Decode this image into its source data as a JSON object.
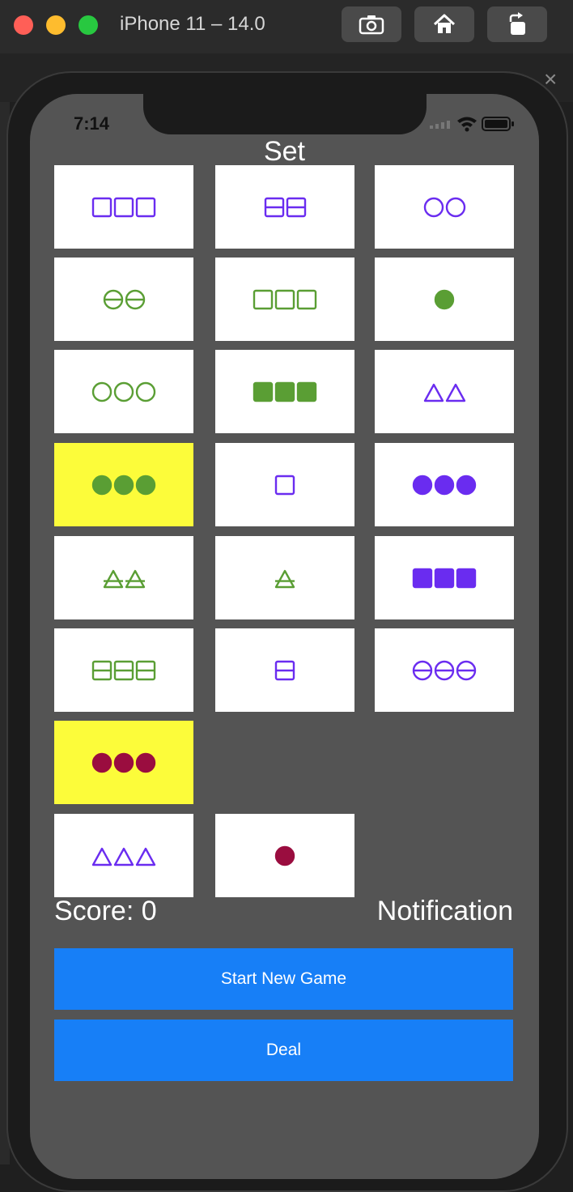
{
  "window": {
    "title": "iPhone 11 – 14.0",
    "toolbar": [
      "screenshot-icon",
      "home-icon",
      "rotate-icon"
    ]
  },
  "status_bar": {
    "time": "7:14",
    "icons": [
      "signal-icon",
      "wifi-icon",
      "battery-icon"
    ]
  },
  "app": {
    "title": "Set"
  },
  "colors": {
    "purple": "#6a2cf0",
    "green": "#5a9e34",
    "maroon": "#9a0d3f",
    "selected": "#fcfc3a",
    "button": "#177ff7"
  },
  "cards": [
    {
      "count": 3,
      "shape": "square",
      "fill": "open",
      "color": "purple",
      "selected": false
    },
    {
      "count": 2,
      "shape": "square",
      "fill": "striped",
      "color": "purple",
      "selected": false
    },
    {
      "count": 2,
      "shape": "circle",
      "fill": "open",
      "color": "purple",
      "selected": false
    },
    {
      "count": 2,
      "shape": "circle",
      "fill": "striped",
      "color": "green",
      "selected": false
    },
    {
      "count": 3,
      "shape": "square",
      "fill": "open",
      "color": "green",
      "selected": false
    },
    {
      "count": 1,
      "shape": "circle",
      "fill": "solid",
      "color": "green",
      "selected": false
    },
    {
      "count": 3,
      "shape": "circle",
      "fill": "open",
      "color": "green",
      "selected": false
    },
    {
      "count": 3,
      "shape": "square",
      "fill": "solid",
      "color": "green",
      "selected": false
    },
    {
      "count": 2,
      "shape": "triangle",
      "fill": "open",
      "color": "purple",
      "selected": false
    },
    {
      "count": 3,
      "shape": "circle",
      "fill": "solid",
      "color": "green",
      "selected": true
    },
    {
      "count": 1,
      "shape": "square",
      "fill": "open",
      "color": "purple",
      "selected": false
    },
    {
      "count": 3,
      "shape": "circle",
      "fill": "solid",
      "color": "purple",
      "selected": false
    },
    {
      "count": 2,
      "shape": "triangle",
      "fill": "striped",
      "color": "green",
      "selected": false
    },
    {
      "count": 1,
      "shape": "triangle",
      "fill": "striped",
      "color": "green",
      "selected": false
    },
    {
      "count": 3,
      "shape": "square",
      "fill": "solid",
      "color": "purple",
      "selected": false
    },
    {
      "count": 3,
      "shape": "square",
      "fill": "striped",
      "color": "green",
      "selected": false
    },
    {
      "count": 1,
      "shape": "square",
      "fill": "striped",
      "color": "purple",
      "selected": false
    },
    {
      "count": 3,
      "shape": "circle",
      "fill": "striped",
      "color": "purple",
      "selected": false
    },
    {
      "count": 3,
      "shape": "circle",
      "fill": "solid",
      "color": "maroon",
      "selected": true
    },
    null,
    null,
    {
      "count": 3,
      "shape": "triangle",
      "fill": "open",
      "color": "purple",
      "selected": false
    },
    {
      "count": 1,
      "shape": "circle",
      "fill": "solid",
      "color": "maroon",
      "selected": false
    }
  ],
  "score_label": "Score: 0",
  "notification": "Notification",
  "buttons": {
    "new_game": "Start New Game",
    "deal": "Deal"
  }
}
